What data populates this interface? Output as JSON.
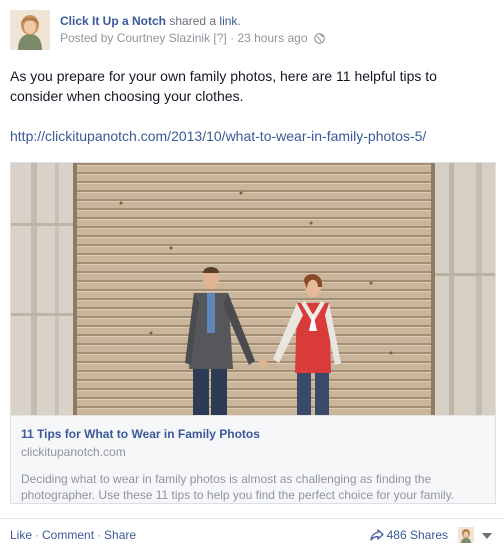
{
  "post": {
    "page_name": "Click It Up a Notch",
    "shared_text": "shared a",
    "link_word": "link",
    "period": ".",
    "posted_by": "Posted by Courtney Slazinik",
    "help_mark": "[?]",
    "time": "· 23 hours ago",
    "body": "As you prepare for your own family photos, here are 11 helpful tips to consider when choosing your clothes.",
    "url": "http://clickitupanotch.com/2013/10/what-to-wear-in-family-photos-5/"
  },
  "card": {
    "title": "11 Tips for What to Wear in Family Photos",
    "domain": "clickitupanotch.com",
    "description": "Deciding what to wear in family photos is almost as challenging as finding the photographer. Use these 11 tips to help you find the perfect choice for your family."
  },
  "footer": {
    "like": "Like",
    "comment": "Comment",
    "share": "Share",
    "separator": "·",
    "shares": "486 Shares"
  },
  "icons": {
    "globe": "globe-icon",
    "share_arrow": "share-arrow-icon",
    "caret": "chevron-down-icon"
  },
  "colors": {
    "link_blue": "#3b5998",
    "meta_gray": "#90949c",
    "text": "#141823",
    "card_bg": "#f6f7f9"
  }
}
